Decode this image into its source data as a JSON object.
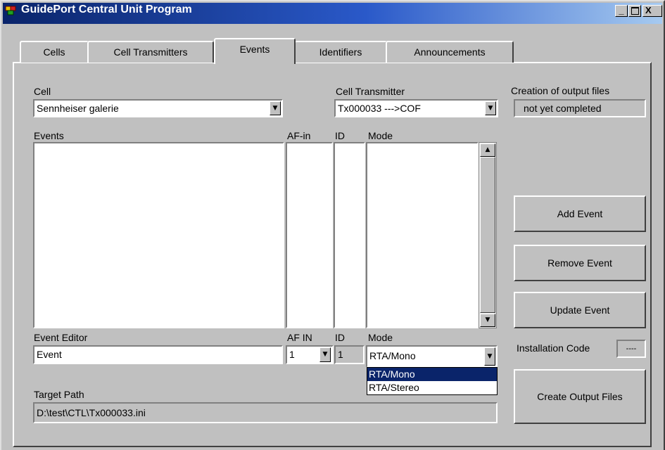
{
  "window": {
    "title": "GuidePort Central Unit Program"
  },
  "tabs": [
    {
      "label": "Cells"
    },
    {
      "label": "Cell Transmitters"
    },
    {
      "label": "Events"
    },
    {
      "label": "Identifiers"
    },
    {
      "label": "Announcements"
    }
  ],
  "cell": {
    "label": "Cell",
    "value": "Sennheiser galerie"
  },
  "cell_transmitter": {
    "label": "Cell Transmitter",
    "value": "Tx000033  --->COF"
  },
  "output_status": {
    "label": "Creation of output files",
    "value": "not yet completed"
  },
  "columns": {
    "events": "Events",
    "af_in": "AF-in",
    "id": "ID",
    "mode": "Mode"
  },
  "editor": {
    "label": "Event Editor",
    "value": "Event",
    "af_label": "AF IN",
    "af_value": "1",
    "id_label": "ID",
    "id_value": "1",
    "mode_label": "Mode",
    "mode_value": "RTA/Mono",
    "mode_options": [
      "RTA/Mono",
      "RTA/Stereo"
    ]
  },
  "target_path": {
    "label": "Target Path",
    "value": "D:\\test\\CTL\\Tx000033.ini"
  },
  "buttons": {
    "add": "Add Event",
    "remove": "Remove Event",
    "update": "Update Event",
    "create": "Create Output Files"
  },
  "installation": {
    "label": "Installation Code",
    "value": "----"
  }
}
